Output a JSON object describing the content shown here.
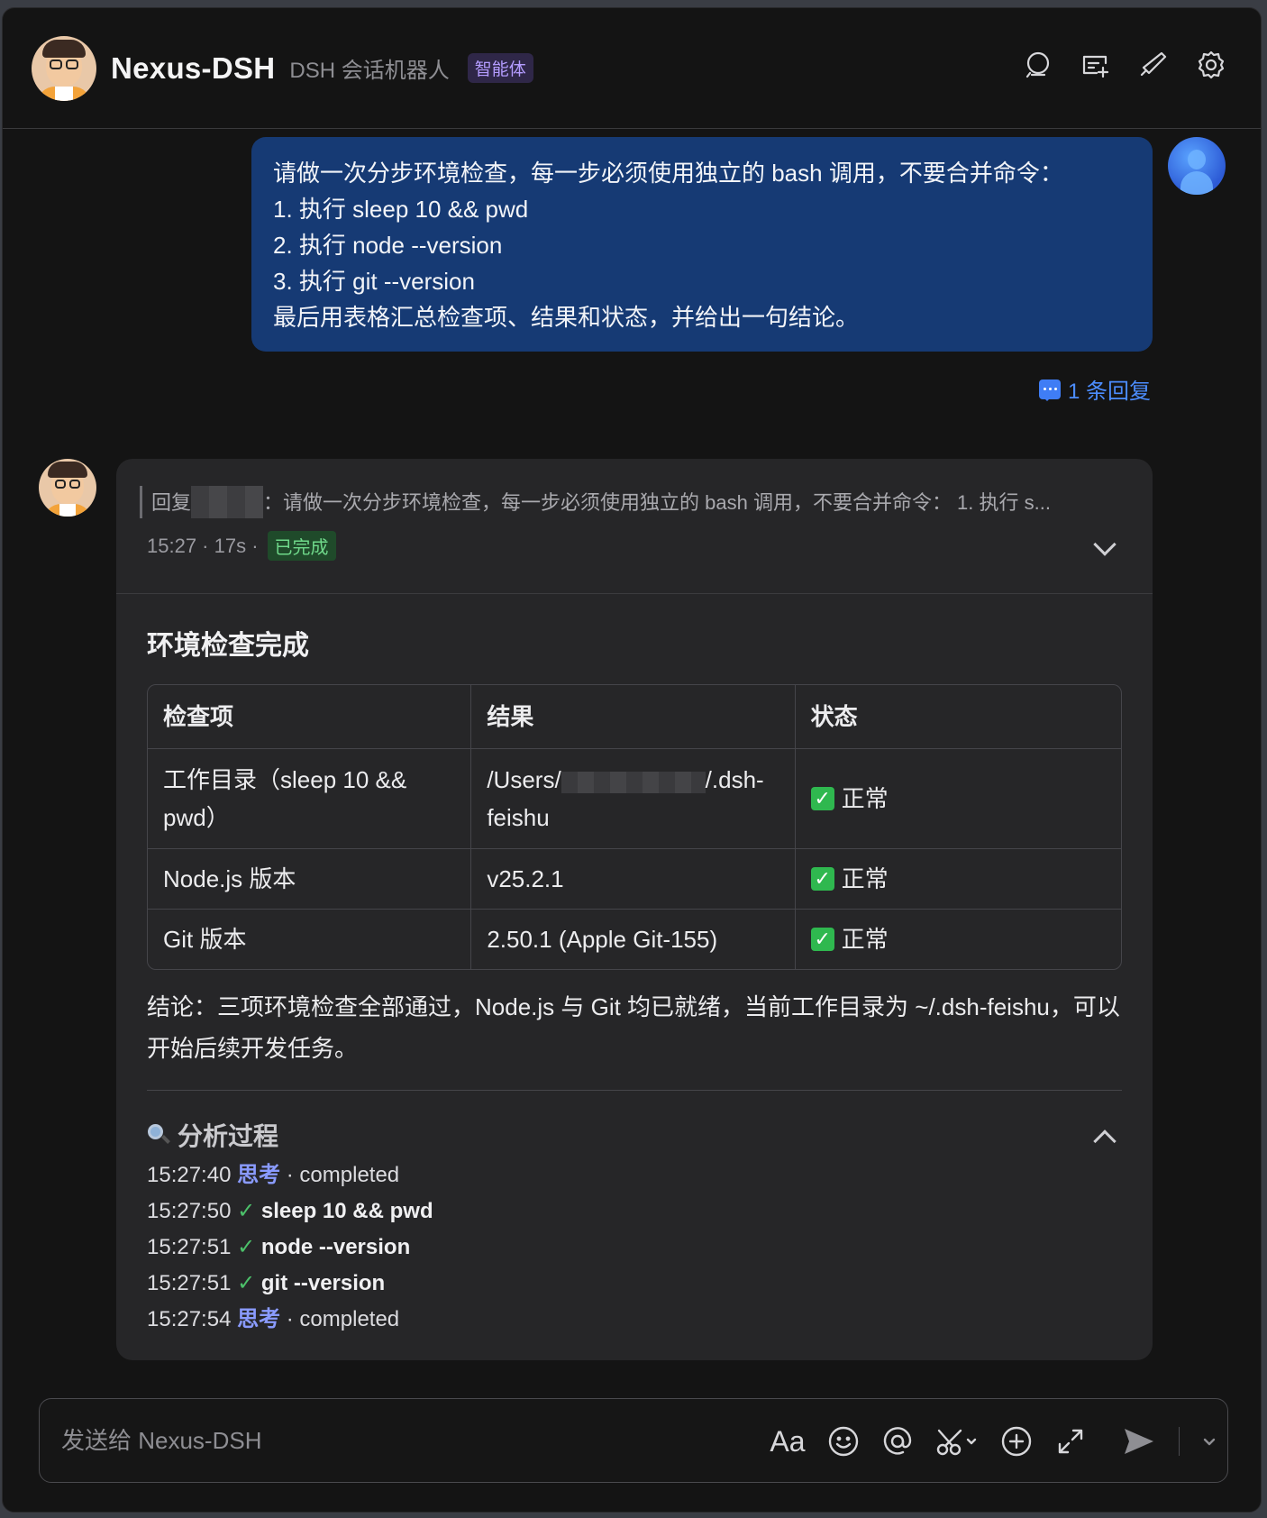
{
  "header": {
    "title": "Nexus-DSH",
    "subtitle": "DSH 会话机器人",
    "badge": "智能体",
    "icons": [
      "search-icon",
      "new-chat-icon",
      "edit-icon",
      "gear-icon"
    ]
  },
  "user_message": {
    "lines": [
      "请做一次分步环境检查，每一步必须使用独立的 bash 调用，不要合并命令：",
      "1. 执行 sleep 10 && pwd",
      "2. 执行 node --version",
      "3. 执行 git --version",
      "最后用表格汇总检查项、结果和状态，并给出一句结论。"
    ],
    "reply_count": "1 条回复"
  },
  "bot_card": {
    "quote_prefix": "回复",
    "quote_text": "：请做一次分步环境检查，每一步必须使用独立的 bash 调用，不要合并命令： 1. 执行 s...",
    "time": "15:27 · 17s ·",
    "status": "已完成",
    "section_title": "环境检查完成",
    "table": {
      "headers": [
        "检查项",
        "结果",
        "状态"
      ],
      "rows": [
        {
          "item": "工作目录（sleep 10 && pwd）",
          "result_prefix": "/Users/",
          "result_suffix": "/.dsh-feishu",
          "status": "正常"
        },
        {
          "item": "Node.js 版本",
          "result": "v25.2.1",
          "status": "正常"
        },
        {
          "item": "Git 版本",
          "result": "2.50.1 (Apple Git-155)",
          "status": "正常"
        }
      ]
    },
    "conclusion": "结论：三项环境检查全部通过，Node.js 与 Git 均已就绪，当前工作目录为 ~/.dsh-feishu，可以开始后续开发任务。",
    "analysis": {
      "title": "分析过程",
      "steps": [
        {
          "time": "15:27:40",
          "label": "思考",
          "detail": "· completed"
        },
        {
          "time": "15:27:50",
          "mark": "✓",
          "cmd": "sleep 10 && pwd"
        },
        {
          "time": "15:27:51",
          "mark": "✓",
          "cmd": "node --version"
        },
        {
          "time": "15:27:51",
          "mark": "✓",
          "cmd": "git --version"
        },
        {
          "time": "15:27:54",
          "label": "思考",
          "detail": "· completed"
        }
      ]
    }
  },
  "composer": {
    "placeholder": "发送给 Nexus-DSH",
    "font_button": "Aa"
  },
  "colors": {
    "user_bubble": "#163a74",
    "card": "#262628",
    "accent": "#4c8dff",
    "success": "#2fb84f"
  }
}
